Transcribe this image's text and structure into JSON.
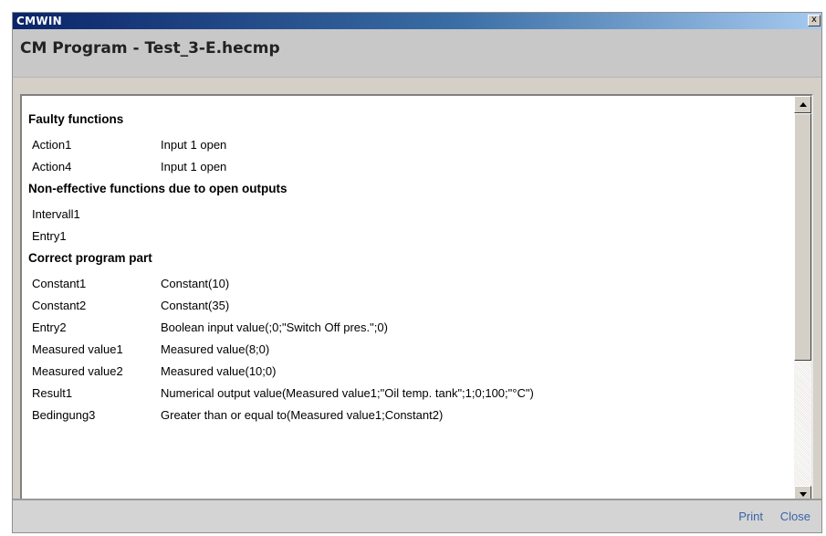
{
  "window": {
    "title": "CMWIN",
    "close_glyph": "x"
  },
  "header": {
    "title": "CM Program - Test_3-E.hecmp"
  },
  "sections": {
    "faulty": {
      "title": "Faulty functions",
      "rows": [
        {
          "name": "Action1",
          "desc": "Input 1 open"
        },
        {
          "name": "Action4",
          "desc": "Input 1 open"
        }
      ]
    },
    "noneffective": {
      "title": "Non-effective functions due to open outputs",
      "rows": [
        {
          "name": "Intervall1",
          "desc": ""
        },
        {
          "name": "Entry1",
          "desc": ""
        }
      ]
    },
    "correct": {
      "title": "Correct program part",
      "rows": [
        {
          "name": "Constant1",
          "desc": "Constant(10)"
        },
        {
          "name": "Constant2",
          "desc": "Constant(35)"
        },
        {
          "name": "Entry2",
          "desc": "Boolean input value(;0;\"Switch Off pres.\";0)"
        },
        {
          "name": "Measured value1",
          "desc": "Measured value(8;0)"
        },
        {
          "name": "Measured value2",
          "desc": "Measured value(10;0)"
        },
        {
          "name": "Result1",
          "desc": "Numerical output value(Measured value1;\"Oil temp. tank\";1;0;100;\"°C\")"
        },
        {
          "name": "Bedingung3",
          "desc": "Greater than or equal to(Measured value1;Constant2)"
        }
      ]
    }
  },
  "footer": {
    "print_label": "Print",
    "close_label": "Close"
  },
  "colors": {
    "title_gradient_start": "#0a246a",
    "link": "#3a64a8"
  },
  "icons": {
    "scroll_up": "scroll-up-arrow-icon",
    "scroll_down": "scroll-down-arrow-icon"
  }
}
